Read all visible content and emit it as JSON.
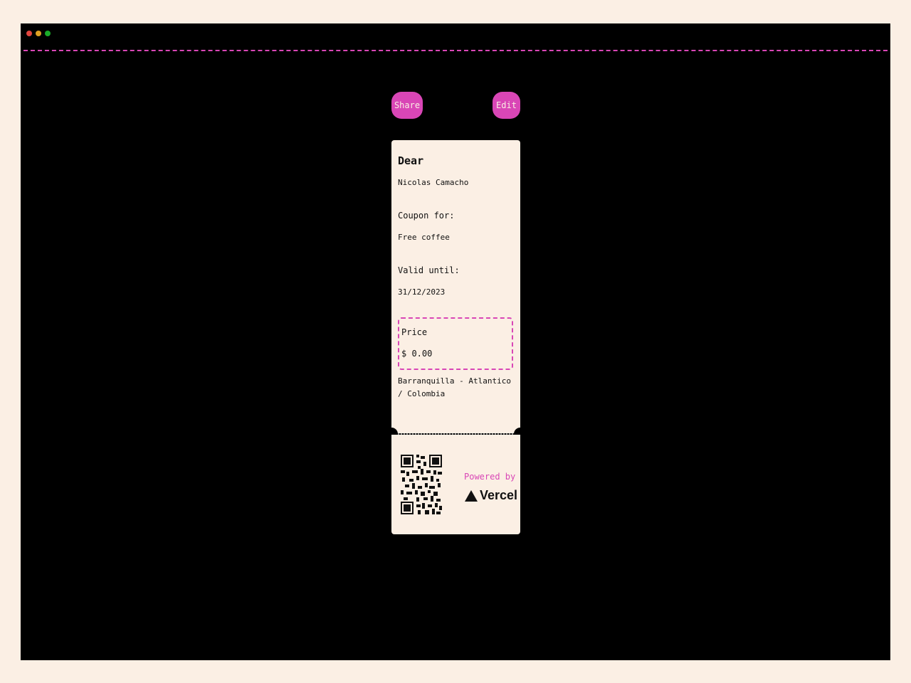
{
  "window": {
    "controls": [
      "close",
      "minimize",
      "maximize"
    ]
  },
  "actions": {
    "share_label": "Share",
    "edit_label": "Edit"
  },
  "ticket": {
    "title": "Dear",
    "name": "Nicolas Camacho",
    "coupon_label": "Coupon for:",
    "coupon_value": "Free coffee",
    "valid_label": "Valid until:",
    "valid_value": "31/12/2023",
    "price_label": "Price",
    "price_value": "$ 0.00",
    "location": "Barranquilla - Atlantico / Colombia",
    "powered_by": "Powered by",
    "brand": "Vercel"
  },
  "colors": {
    "accent": "#d946b6",
    "ticket_bg": "#fbefe4",
    "window_bg": "#000000",
    "page_bg": "#fbefe4"
  },
  "icons": [
    "window-close-icon",
    "window-minimize-icon",
    "window-maximize-icon",
    "qr-code-icon",
    "vercel-logo-icon"
  ]
}
